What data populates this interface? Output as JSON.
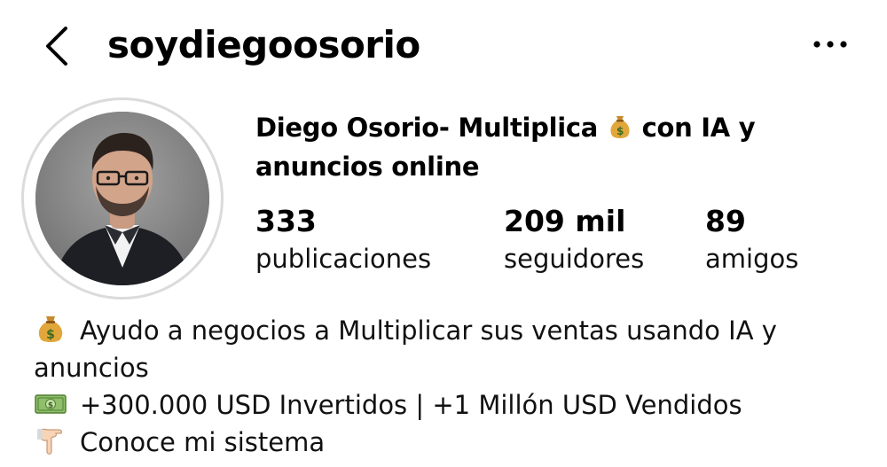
{
  "header": {
    "username": "soydiegoosorio",
    "back_icon": "chevron-left-icon",
    "more_icon": "more-horizontal-icon"
  },
  "profile": {
    "avatar_description_icon": "avatar",
    "display_name_part1": "Diego Osorio- Multiplica ",
    "display_name_emoji": "money-bag-icon",
    "display_name_part2": " con IA y anuncios online"
  },
  "stats": {
    "posts_count": "333",
    "posts_label": "publicaciones",
    "followers_count": "209 mil",
    "followers_label": "seguidores",
    "friends_count": "89",
    "friends_label": "amigos"
  },
  "bio": {
    "line1_icon": "money-bag-icon",
    "line1": "Ayudo a negocios a Multiplicar sus ventas usando IA y",
    "line1_cont": "anuncios",
    "line2_icon": "dollar-banknote-icon",
    "line2": "+300.000 USD Invertidos | +1 Millón USD Vendidos",
    "line3_icon": "pointing-down-hand-icon",
    "line3": "Conoce mi sistema"
  },
  "colors": {
    "text": "#000000",
    "avatar_ring": "#dbdbdb",
    "background": "#ffffff"
  }
}
